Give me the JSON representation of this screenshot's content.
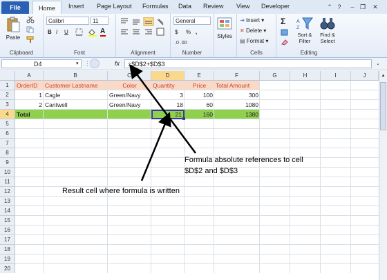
{
  "tabs": [
    "File",
    "Home",
    "Insert",
    "Page Layout",
    "Formulas",
    "Data",
    "Review",
    "View",
    "Developer"
  ],
  "ribbon": {
    "paste": "Paste",
    "font_name": "Calibri",
    "font_size": "11",
    "bold": "B",
    "italic": "I",
    "underline": "U",
    "grow_font": "A",
    "number_format": "General",
    "currency": "$",
    "percent": "%",
    "comma": ",",
    "styles": "Styles",
    "insert": "Insert",
    "delete": "Delete",
    "format": "Format",
    "sigma": "Σ",
    "sort_filter": "Sort & Filter",
    "find_select": "Find & Select",
    "groups": [
      "Clipboard",
      "Font",
      "Alignment",
      "Number",
      "Cells",
      "Editing"
    ]
  },
  "formula_bar": {
    "name_box": "D4",
    "fx": "fx",
    "formula": "=$D$2+$D$3"
  },
  "grid": {
    "columns": [
      "A",
      "B",
      "C",
      "D",
      "E",
      "F",
      "G",
      "H",
      "I",
      "J"
    ],
    "rows": [
      "1",
      "2",
      "3",
      "4",
      "5",
      "6",
      "7",
      "8",
      "9",
      "10",
      "11",
      "12",
      "13",
      "14",
      "15",
      "16",
      "17",
      "18",
      "19",
      "20"
    ],
    "header": [
      "OrderID",
      "Customer Lastname",
      "Color",
      "Quantity",
      "Price",
      "Total Amount"
    ],
    "data": [
      [
        "1",
        "Cagle",
        "Green/Navy",
        "3",
        "100",
        "300"
      ],
      [
        "2",
        "Cantwell",
        "Green/Navy",
        "18",
        "60",
        "1080"
      ]
    ],
    "total": [
      "Total",
      "",
      "",
      "21",
      "160",
      "1380"
    ]
  },
  "annotations": {
    "formula_note_line1": "Formula absolute references to cell",
    "formula_note_line2": "$D$2  and $D$3",
    "result_note": "Result cell where formula is written"
  },
  "colors": {
    "header_fill": "#fbd9c7",
    "header_text": "#c0462b",
    "total_fill": "#8fd14f",
    "file_tab": "#2a61b5"
  }
}
